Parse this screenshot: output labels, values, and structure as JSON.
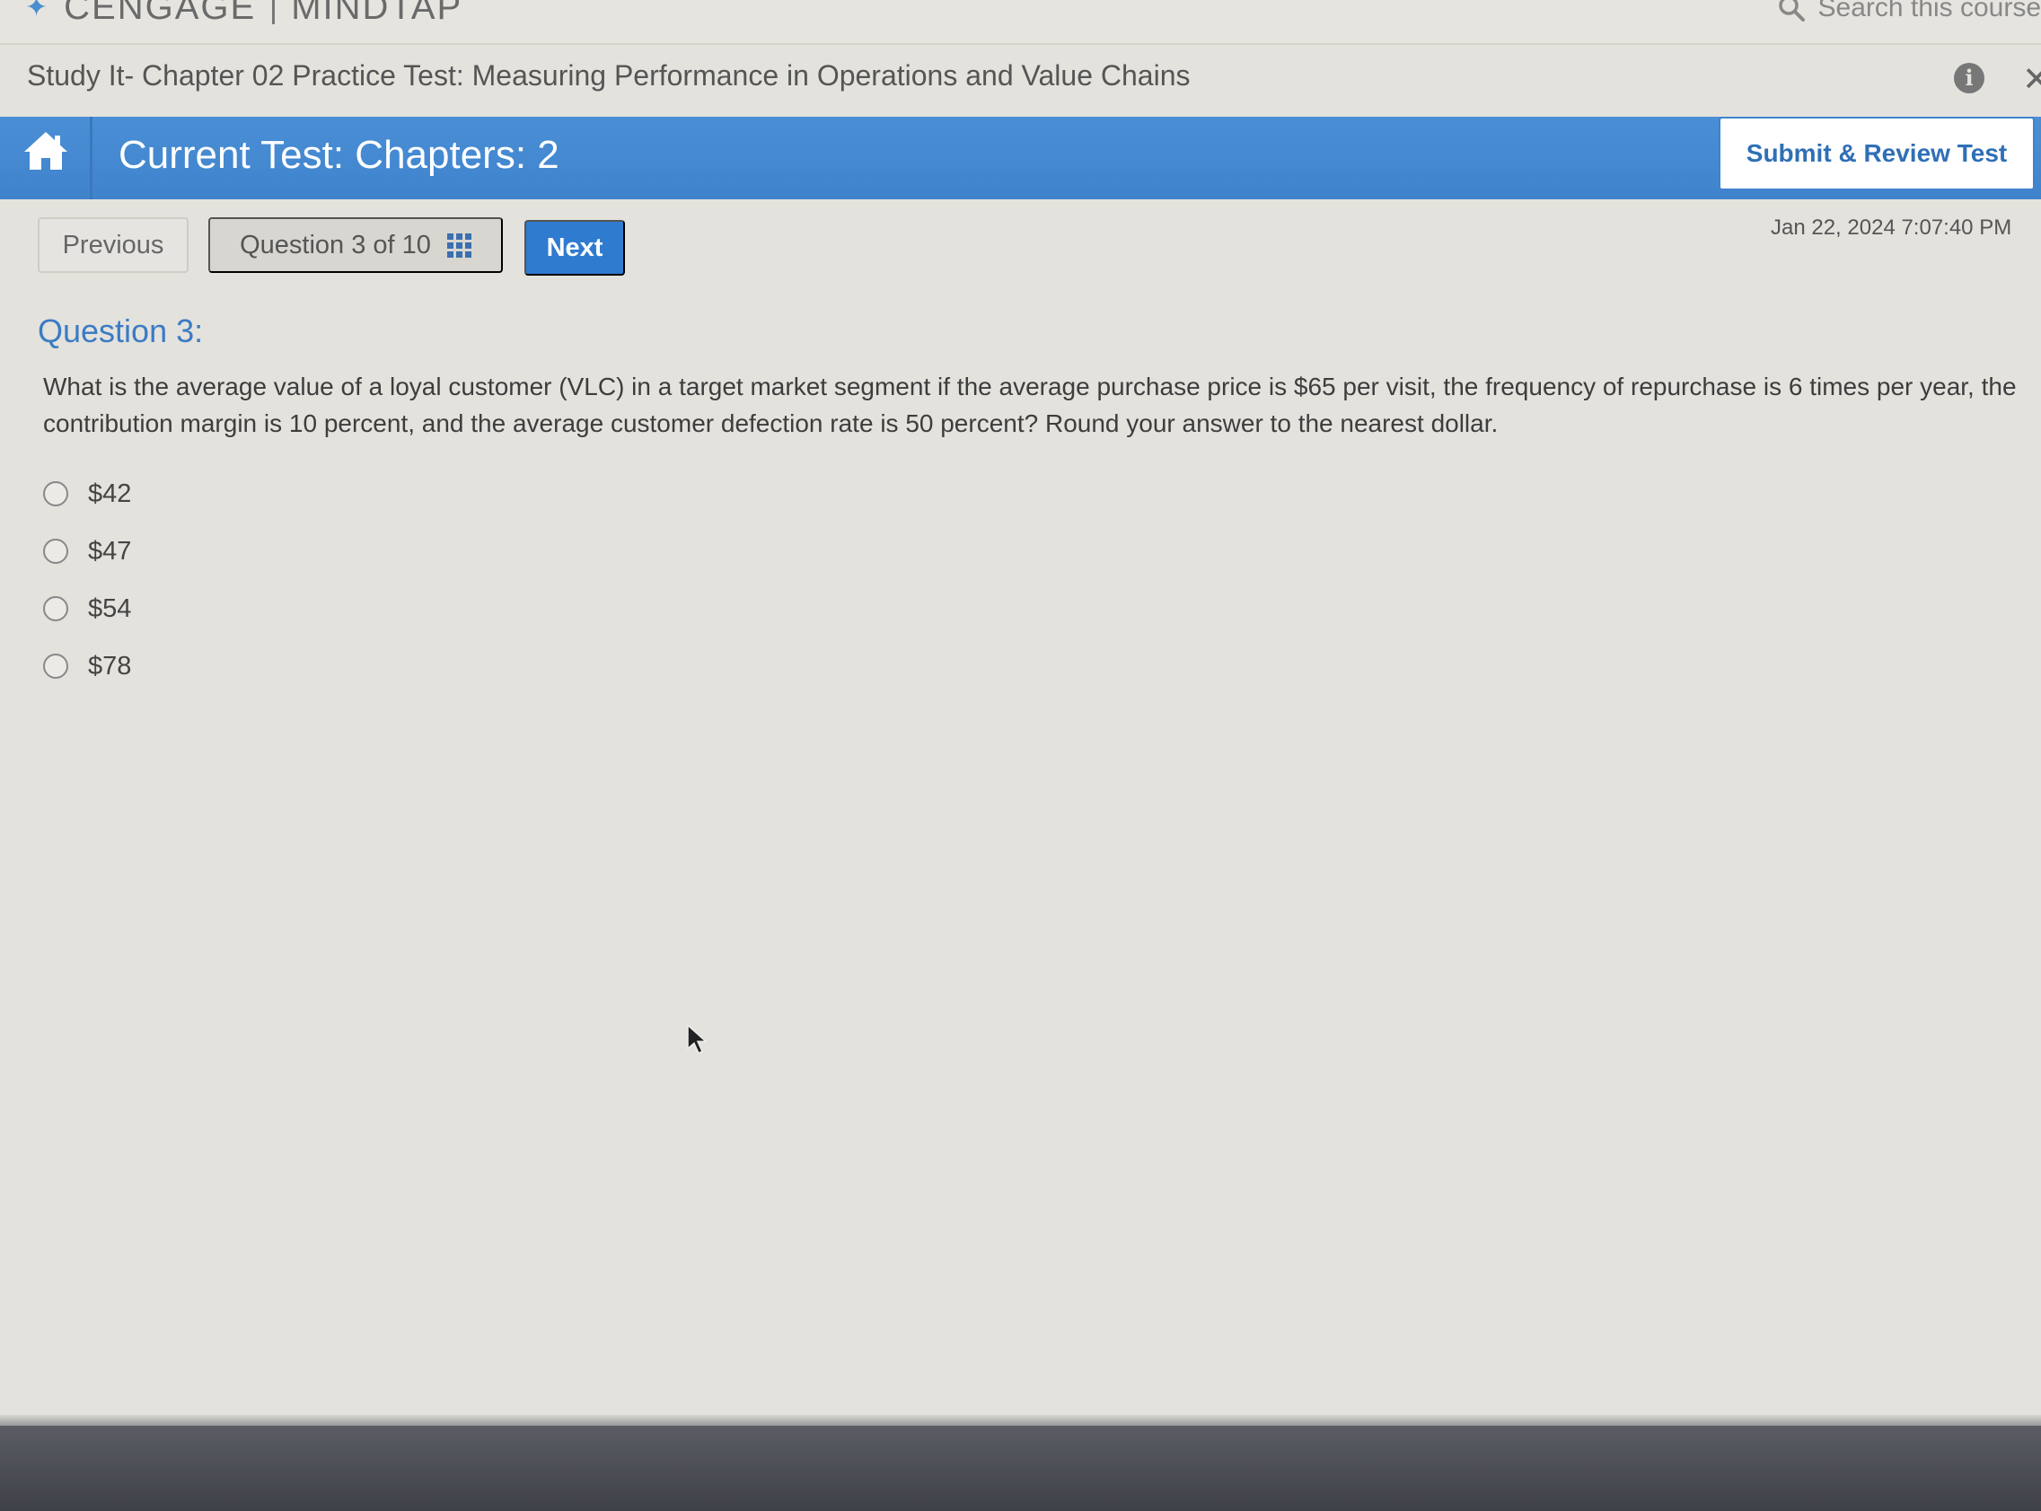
{
  "brand": {
    "left": "CENGAGE",
    "right": "MINDTAP"
  },
  "search": {
    "placeholder": "Search this course"
  },
  "course": {
    "title": "Study It- Chapter 02 Practice Test: Measuring Performance in Operations and Value Chains"
  },
  "header": {
    "current_test": "Current Test: Chapters: 2",
    "submit_label": "Submit & Review Test"
  },
  "nav": {
    "previous_label": "Previous",
    "question_selector": "Question 3 of 10",
    "next_label": "Next",
    "timestamp": "Jan 22, 2024 7:07:40 PM"
  },
  "question": {
    "heading": "Question 3:",
    "text": "What is the average value of a loyal customer (VLC) in a target market segment if the average purchase price is $65 per visit, the frequency of repurchase is 6 times per year, the contribution margin is 10 percent, and the average customer defection rate is 50 percent? Round your answer to the nearest dollar.",
    "options": [
      {
        "label": "$42",
        "selected": false
      },
      {
        "label": "$47",
        "selected": false
      },
      {
        "label": "$54",
        "selected": false
      },
      {
        "label": "$78",
        "selected": false
      }
    ]
  },
  "icons": {
    "home": "home-icon",
    "info": "info-icon",
    "close": "close-icon",
    "search": "search-icon",
    "grid": "grid-icon"
  },
  "colors": {
    "header_blue": "#4289d2",
    "next_blue": "#2e7bd0",
    "question_heading": "#3a7cc4"
  }
}
